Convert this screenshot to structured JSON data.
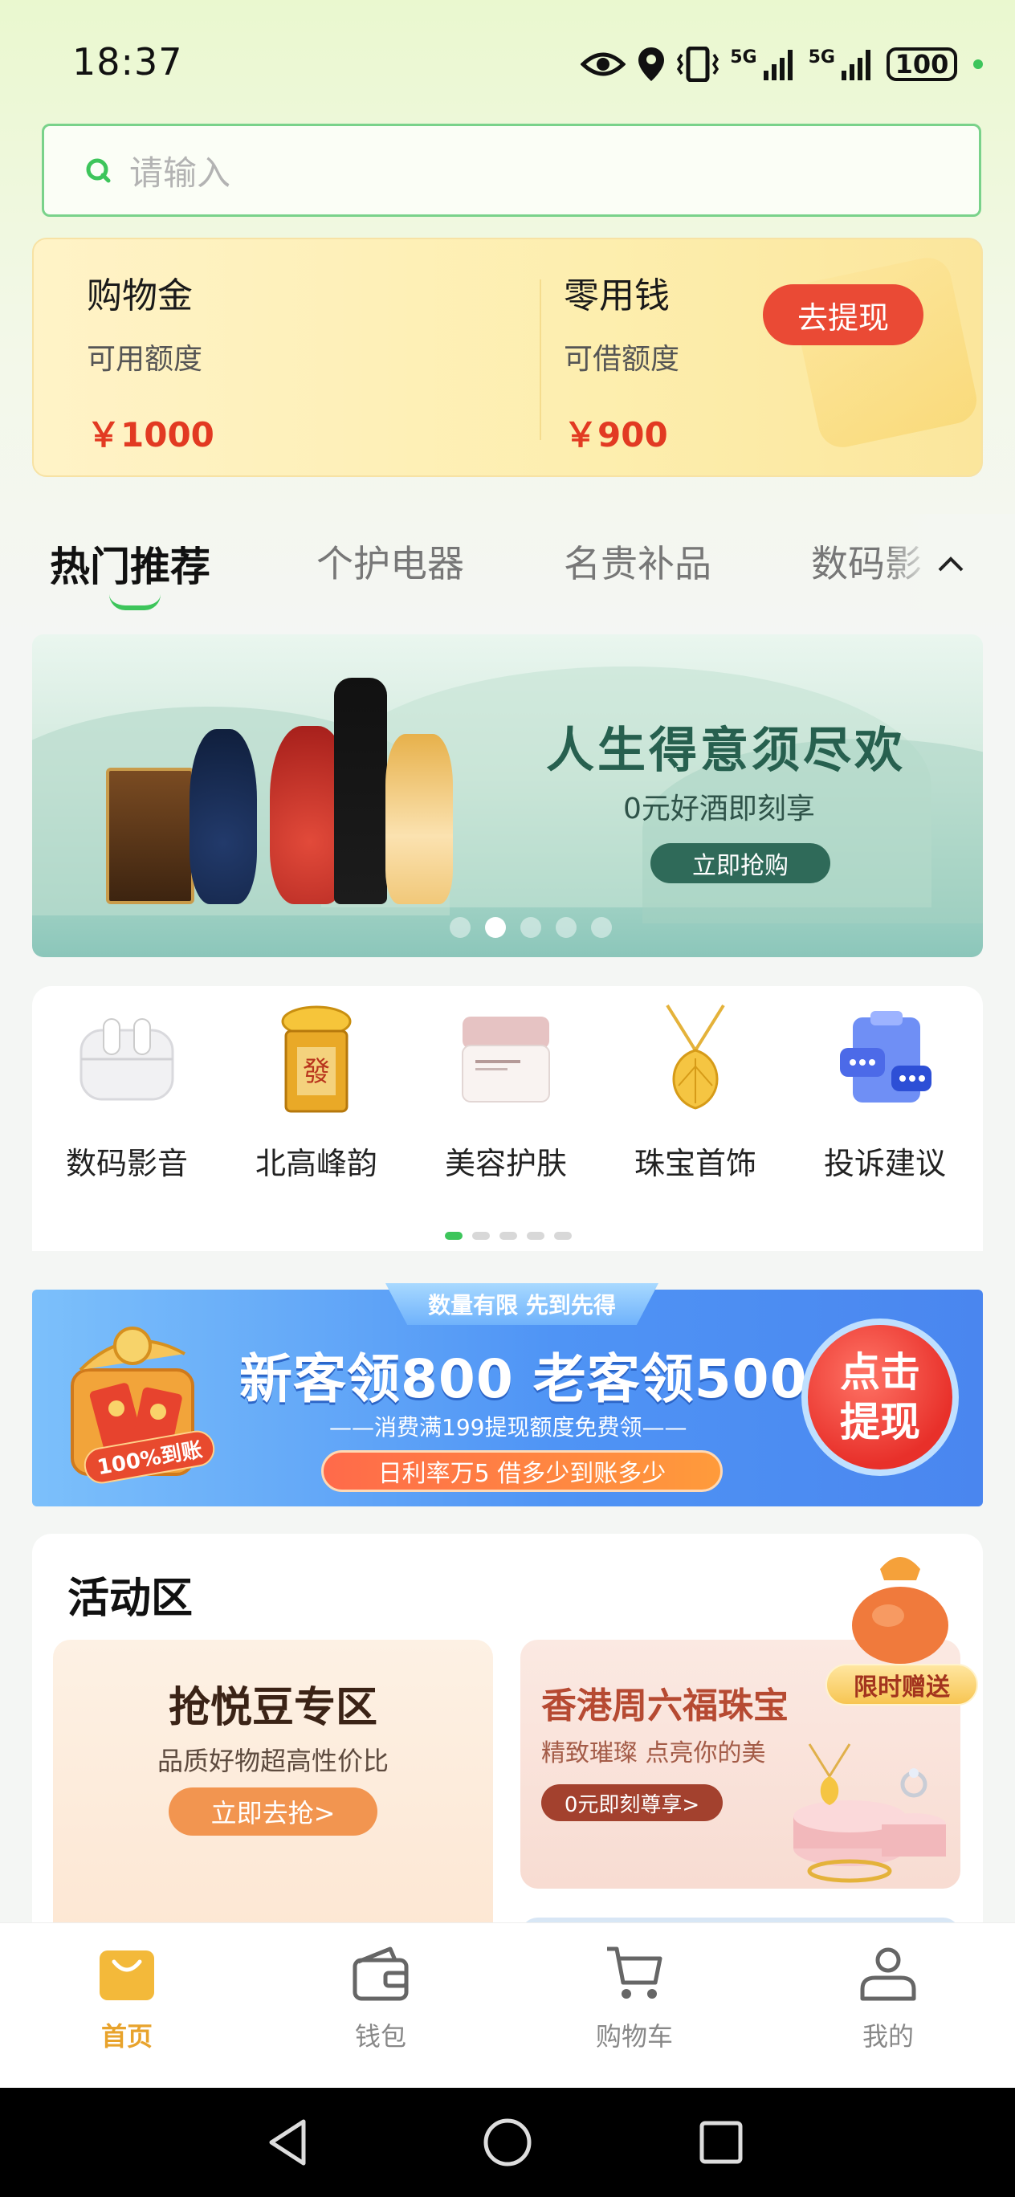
{
  "status_bar": {
    "time": "18:37",
    "network_1": "5G",
    "network_2": "5G",
    "battery": "100"
  },
  "search": {
    "placeholder": "请输入"
  },
  "credit": {
    "shopping": {
      "title": "购物金",
      "subtitle": "可用额度",
      "amount": "￥1000"
    },
    "pocket": {
      "title": "零用钱",
      "subtitle": "可借额度",
      "amount": "￥900"
    },
    "withdraw_label": "去提现"
  },
  "tabs": [
    {
      "label": "热门推荐",
      "active": true
    },
    {
      "label": "个护电器",
      "active": false
    },
    {
      "label": "名贵补品",
      "active": false
    },
    {
      "label": "数码影",
      "active": false
    }
  ],
  "banner": {
    "title": "人生得意须尽欢",
    "subtitle": "0元好酒即刻享",
    "button": "立即抢购",
    "slide_count": 5,
    "active_slide": 2
  },
  "categories": [
    {
      "label": "数码影音",
      "icon": "earbuds-icon"
    },
    {
      "label": "北高峰韵",
      "icon": "gold-ingot-icon"
    },
    {
      "label": "美容护肤",
      "icon": "cream-jar-icon"
    },
    {
      "label": "珠宝首饰",
      "icon": "necklace-icon"
    },
    {
      "label": "投诉建议",
      "icon": "feedback-icon"
    }
  ],
  "promo": {
    "tag": "数量有限 先到先得",
    "title": "新客领800 老客领500",
    "subtitle": "——消费满199提现额度免费领——",
    "pill": "日利率万5 借多少到账多少",
    "circle": "点击提现",
    "gift_label": "100%到账"
  },
  "activity": {
    "title": "活动区",
    "left_card": {
      "title": "抢悦豆专区",
      "subtitle": "品质好物超高性价比",
      "button": "立即去抢>"
    },
    "right_card": {
      "title": "香港周六福珠宝",
      "subtitle": "精致璀璨 点亮你的美",
      "button": "0元即刻尊享>",
      "badge": "限时赠送"
    }
  },
  "bottom_nav": [
    {
      "label": "首页",
      "icon": "home-bag-icon",
      "active": true
    },
    {
      "label": "钱包",
      "icon": "wallet-icon",
      "active": false
    },
    {
      "label": "购物车",
      "icon": "cart-icon",
      "active": false
    },
    {
      "label": "我的",
      "icon": "profile-icon",
      "active": false
    }
  ],
  "colors": {
    "accent_green": "#3dc55b",
    "red": "#e23a22",
    "nav_active": "#e8a32c"
  }
}
